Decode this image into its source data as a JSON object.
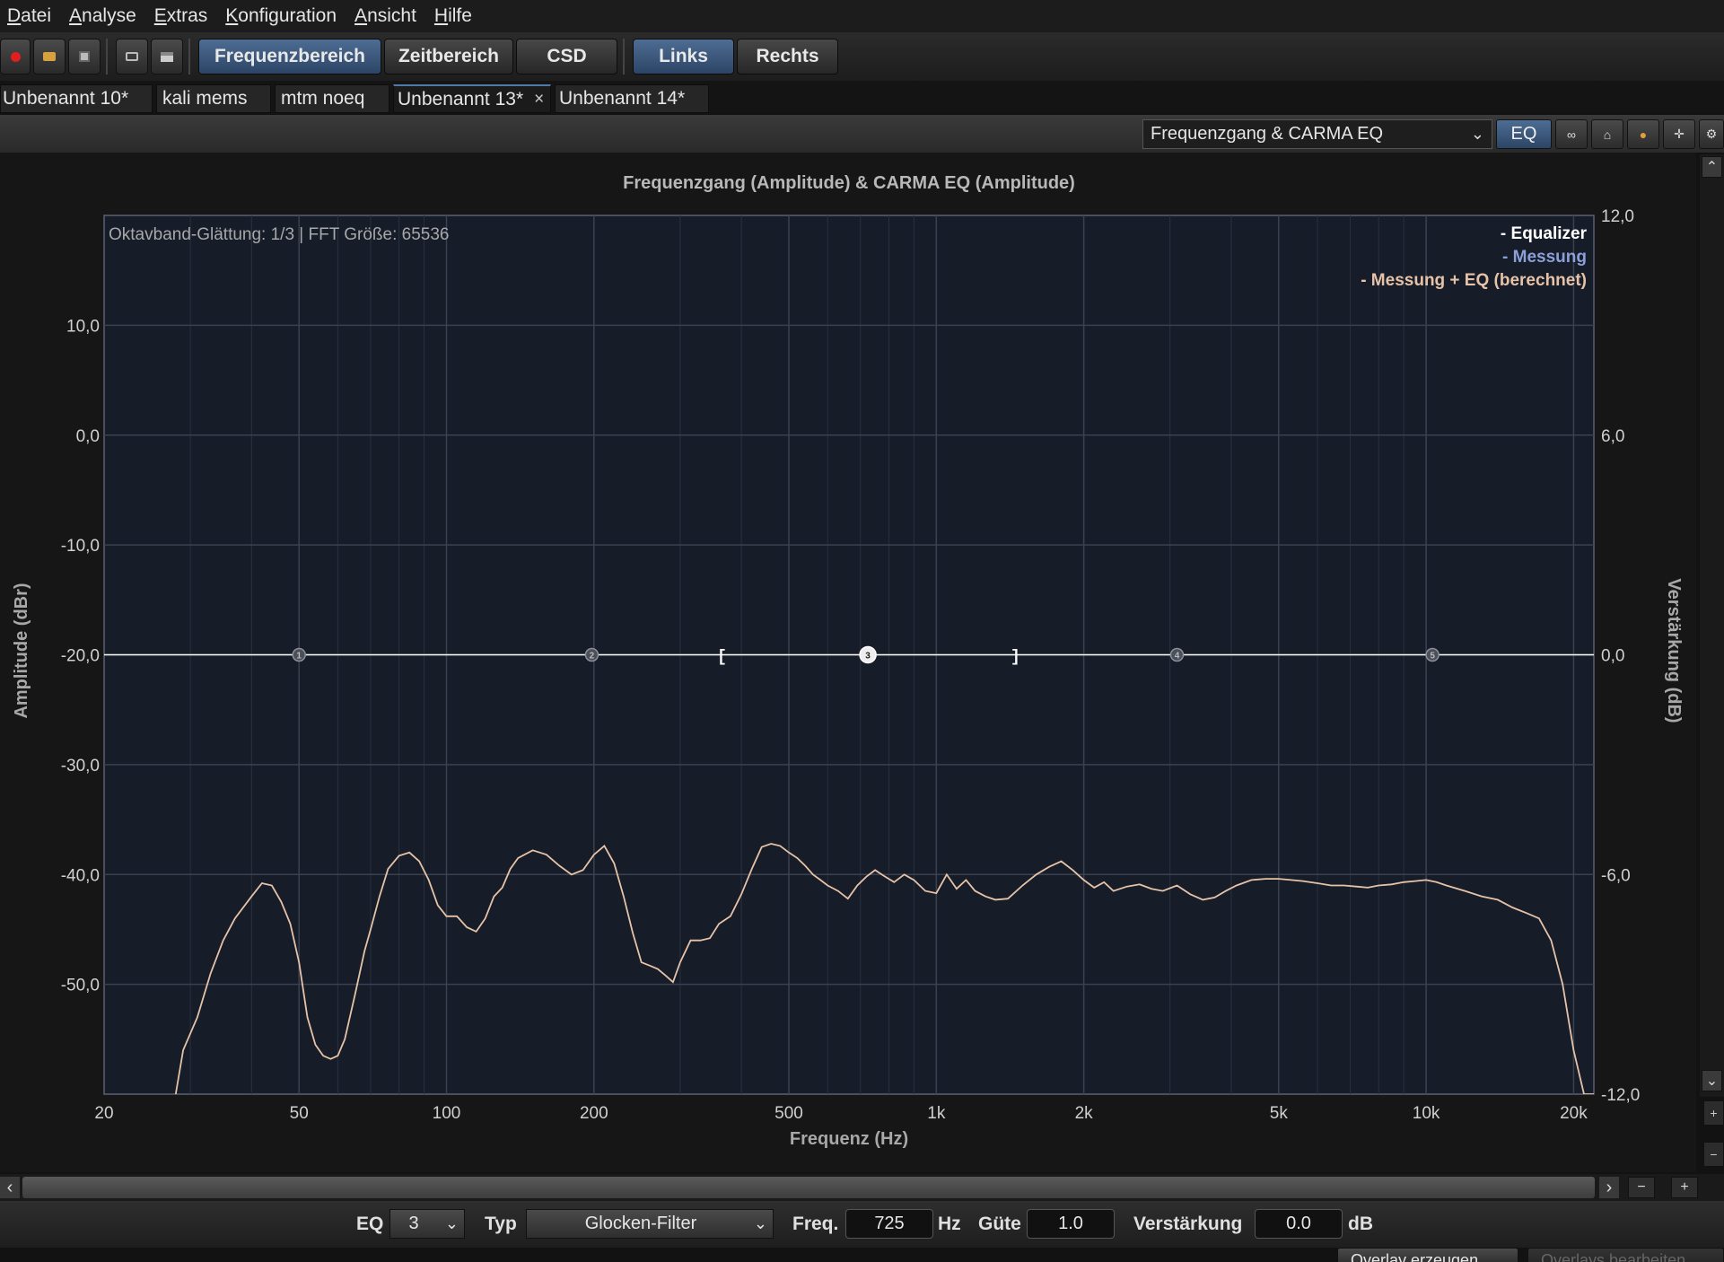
{
  "menu": {
    "items": [
      {
        "id": "datei",
        "first": "D",
        "rest": "atei"
      },
      {
        "id": "analyse",
        "first": "A",
        "rest": "nalyse"
      },
      {
        "id": "extras",
        "first": "E",
        "rest": "xtras"
      },
      {
        "id": "konfiguration",
        "first": "K",
        "rest": "onfiguration"
      },
      {
        "id": "ansicht",
        "first": "A",
        "rest": "nsicht"
      },
      {
        "id": "hilfe",
        "first": "H",
        "rest": "ilfe"
      }
    ]
  },
  "toolbar": {
    "icons": [
      "record-icon",
      "open-folder-icon",
      "save-icon",
      "screenshot-icon",
      "print-icon"
    ],
    "view_buttons": [
      "Frequenzbereich",
      "Zeitbereich",
      "CSD"
    ],
    "channel_buttons": [
      "Links",
      "Rechts"
    ]
  },
  "tabs": [
    "Unbenannt 10*",
    "kali mems",
    "mtm noeq",
    "Unbenannt 13*",
    "Unbenannt 14*"
  ],
  "tab_close": "×",
  "view": {
    "selected": "Frequenzgang & CARMA EQ",
    "eq_button": "EQ"
  },
  "chart_data": {
    "type": "line",
    "title": "Frequenzgang (Amplitude) & CARMA EQ (Amplitude)",
    "info": "Oktavband-Glättung: 1/3 | FFT Größe: 65536",
    "xlabel": "Frequenz (Hz)",
    "ylabel_left": "Amplitude (dBr)",
    "ylabel_right": "Verstärkung (dB)",
    "x_scale": "log",
    "xlim": [
      20,
      22000
    ],
    "ylim_left": [
      -60,
      20
    ],
    "ylim_right": [
      -12,
      12
    ],
    "x_ticks": [
      "20",
      "50",
      "100",
      "200",
      "500",
      "1k",
      "2k",
      "5k",
      "10k",
      "20k"
    ],
    "y_ticks_left": [
      "10,0",
      "0,0",
      "-10,0",
      "-20,0",
      "-30,0",
      "-40,0",
      "-50,0"
    ],
    "y_ticks_right": [
      "12,0",
      "6,0",
      "0,0",
      "-6,0",
      "-12,0"
    ],
    "legend": [
      "- Equalizer",
      "- Messung",
      "- Messung + EQ (berechnet)"
    ],
    "legend_position": "top-right",
    "colors": {
      "equalizer": "#ffffff",
      "messung": "#8ca0d8",
      "messung_eq": "#e6c3a8",
      "plot_bg": "#161c28",
      "grid": "#3a4150"
    },
    "equalizer_gain_db": 0,
    "eq_points": [
      {
        "id": "1",
        "freq": 50
      },
      {
        "id": "2",
        "freq": 198
      },
      {
        "id": "3",
        "freq": 725
      },
      {
        "id": "4",
        "freq": 3100
      },
      {
        "id": "5",
        "freq": 10300
      }
    ],
    "eq_band": {
      "left_marker": "[",
      "right_marker": "]",
      "from_freq": 365,
      "to_freq": 1450
    },
    "series": [
      {
        "name": "- Messung + EQ (berechnet)",
        "x": [
          28,
          29,
          31,
          33,
          35,
          37,
          40,
          42,
          44,
          46,
          48,
          50,
          52,
          54,
          56,
          58,
          60,
          62,
          65,
          68,
          70,
          73,
          76,
          80,
          84,
          88,
          92,
          96,
          100,
          105,
          110,
          115,
          120,
          125,
          130,
          135,
          140,
          150,
          160,
          170,
          180,
          190,
          200,
          210,
          220,
          230,
          240,
          250,
          260,
          270,
          280,
          290,
          300,
          315,
          330,
          345,
          360,
          380,
          400,
          420,
          440,
          460,
          480,
          500,
          520,
          540,
          560,
          580,
          600,
          630,
          660,
          690,
          720,
          750,
          780,
          820,
          860,
          900,
          950,
          1000,
          1050,
          1100,
          1150,
          1200,
          1260,
          1320,
          1400,
          1500,
          1600,
          1700,
          1800,
          1900,
          2000,
          2100,
          2200,
          2300,
          2450,
          2600,
          2750,
          2900,
          3100,
          3300,
          3500,
          3700,
          3900,
          4100,
          4400,
          4700,
          5000,
          5300,
          5600,
          6000,
          6400,
          6800,
          7200,
          7600,
          8000,
          8500,
          9000,
          9500,
          10000,
          10500,
          11000,
          12000,
          13000,
          14000,
          15000,
          16000,
          17000,
          18000,
          19000,
          20000,
          21000,
          22000
        ],
        "values": [
          -60,
          -56,
          -53,
          -49,
          -46,
          -44,
          -42,
          -40.8,
          -41,
          -42.5,
          -44.5,
          -48,
          -53,
          -55.5,
          -56.5,
          -56.8,
          -56.5,
          -55,
          -51,
          -47,
          -45,
          -42,
          -39.5,
          -38.3,
          -38,
          -38.8,
          -40.5,
          -42.8,
          -43.8,
          -43.8,
          -44.8,
          -45.2,
          -44,
          -42,
          -41.2,
          -39.5,
          -38.5,
          -37.8,
          -38.2,
          -39.2,
          -40,
          -39.6,
          -38.2,
          -37.4,
          -39,
          -42,
          -45.3,
          -48,
          -48.3,
          -48.6,
          -49.2,
          -49.8,
          -48,
          -46,
          -46,
          -45.8,
          -44.5,
          -43.8,
          -41.8,
          -39.5,
          -37.5,
          -37.2,
          -37.4,
          -38,
          -38.5,
          -39.2,
          -40,
          -40.5,
          -41,
          -41.5,
          -42.2,
          -41,
          -40.2,
          -39.6,
          -40.1,
          -40.7,
          -40,
          -40.5,
          -41.5,
          -41.7,
          -40,
          -41.3,
          -40.5,
          -41.5,
          -42,
          -42.3,
          -42.2,
          -41,
          -40,
          -39.3,
          -38.8,
          -39.6,
          -40.5,
          -41.2,
          -40.7,
          -41.5,
          -41.1,
          -40.9,
          -41.3,
          -41.5,
          -41,
          -41.8,
          -42.3,
          -42.1,
          -41.5,
          -41,
          -40.5,
          -40.4,
          -40.4,
          -40.5,
          -40.6,
          -40.8,
          -41,
          -41,
          -41.1,
          -41.2,
          -41,
          -40.9,
          -40.7,
          -40.6,
          -40.5,
          -40.7,
          -41,
          -41.5,
          -42,
          -42.3,
          -43,
          -43.5,
          -44,
          -46,
          -50,
          -56,
          -60,
          -60
        ]
      }
    ]
  },
  "eq_params": {
    "eq_label": "EQ",
    "eq_value": "3",
    "typ_label": "Typ",
    "typ_value": "Glocken-Filter",
    "freq_label": "Freq.",
    "freq_value": "725",
    "freq_unit": "Hz",
    "guete_label": "Güte",
    "guete_value": "1.0",
    "gain_label": "Verstärkung",
    "gain_value": "0.0",
    "gain_unit": "dB"
  },
  "bottom": {
    "overlay_create": "Overlay erzeugen",
    "overlay_edit": "Overlays bearbeiten"
  }
}
